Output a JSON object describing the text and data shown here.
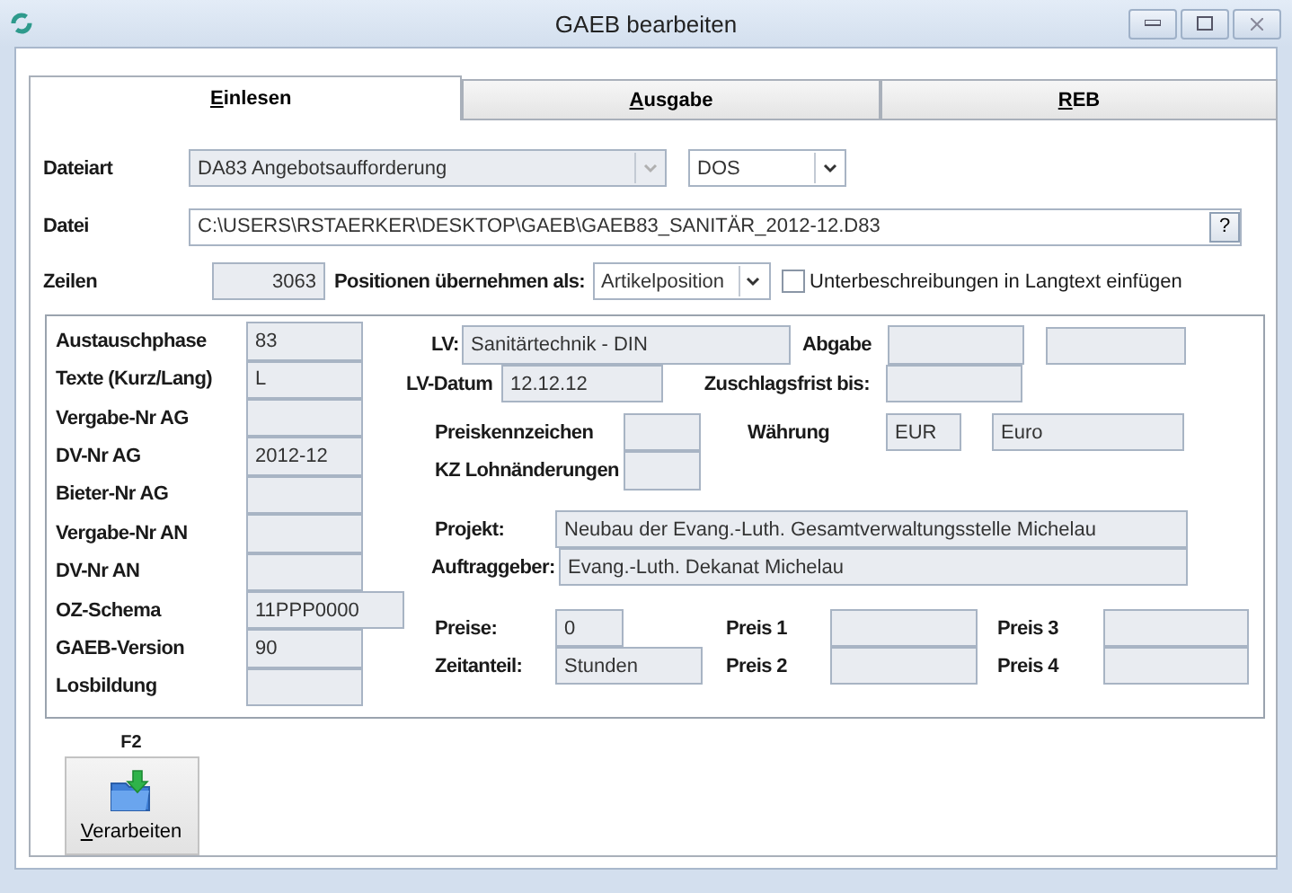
{
  "window": {
    "title": "GAEB bearbeiten"
  },
  "tabs": [
    {
      "label": "Einlesen",
      "selected": true
    },
    {
      "label": "Ausgabe",
      "selected": false
    },
    {
      "label": "REB",
      "selected": false
    }
  ],
  "file_type": {
    "label": "Dateiart",
    "value": "DA83 Angebotsaufforderung",
    "disabled": true,
    "encoding": "DOS"
  },
  "file": {
    "label": "Datei",
    "value": "C:\\USERS\\RSTAERKER\\DESKTOP\\GAEB\\GAEB83_SANITÄR_2012-12.D83",
    "button": "?"
  },
  "lines": {
    "label": "Zeilen",
    "value": "3063",
    "positions_label": "Positionen übernehmen als:",
    "positions_value": "Artikelposition",
    "checkbox": {
      "label": "Unterbeschreibungen in Langtext einfügen",
      "checked": false
    }
  },
  "info": [
    {
      "label": "Austauschphase",
      "value": "83"
    },
    {
      "label": "Texte (Kurz/Lang)",
      "value": "L"
    },
    {
      "label": "Vergabe-Nr AG"
    },
    {
      "label": "DV-Nr AG",
      "value": "2012-12"
    },
    {
      "label": "Bieter-Nr AG"
    },
    {
      "label": "Vergabe-Nr AN"
    },
    {
      "label": "DV-Nr AN"
    },
    {
      "label": "OZ-Schema",
      "value": "11PPP0000"
    },
    {
      "label": "GAEB-Version",
      "value": "90"
    },
    {
      "label": "Losbildung"
    }
  ],
  "details": {
    "lv": {
      "label": "LV:",
      "value": "Sanitärtechnik - DIN"
    },
    "lv_date": {
      "label": "LV-Datum",
      "value": "12.12.12"
    },
    "submission": {
      "label": "Abgabe"
    },
    "award_deadline": {
      "label": "Zuschlagsfrist bis:"
    },
    "price_code": {
      "label": "Preiskennzeichen"
    },
    "wage_change": {
      "label": "KZ Lohnänderungen"
    },
    "currency": {
      "label": "Währung",
      "code": "EUR",
      "name": "Euro"
    },
    "project": {
      "label": "Projekt:",
      "value": "Neubau der Evang.-Luth. Gesamtverwaltungsstelle Michelau"
    },
    "client": {
      "label": "Auftraggeber:",
      "value": "Evang.-Luth. Dekanat Michelau"
    },
    "prices": {
      "label": "Preise:",
      "value": "0"
    },
    "time_share": {
      "label": "Zeitanteil:",
      "value": "Stunden"
    },
    "price_fields": [
      {
        "label": "Preis 1"
      },
      {
        "label": "Preis 2"
      },
      {
        "label": "Preis 3"
      },
      {
        "label": "Preis 4"
      }
    ]
  },
  "action": {
    "shortcut": "F2",
    "label": "Verarbeiten"
  }
}
